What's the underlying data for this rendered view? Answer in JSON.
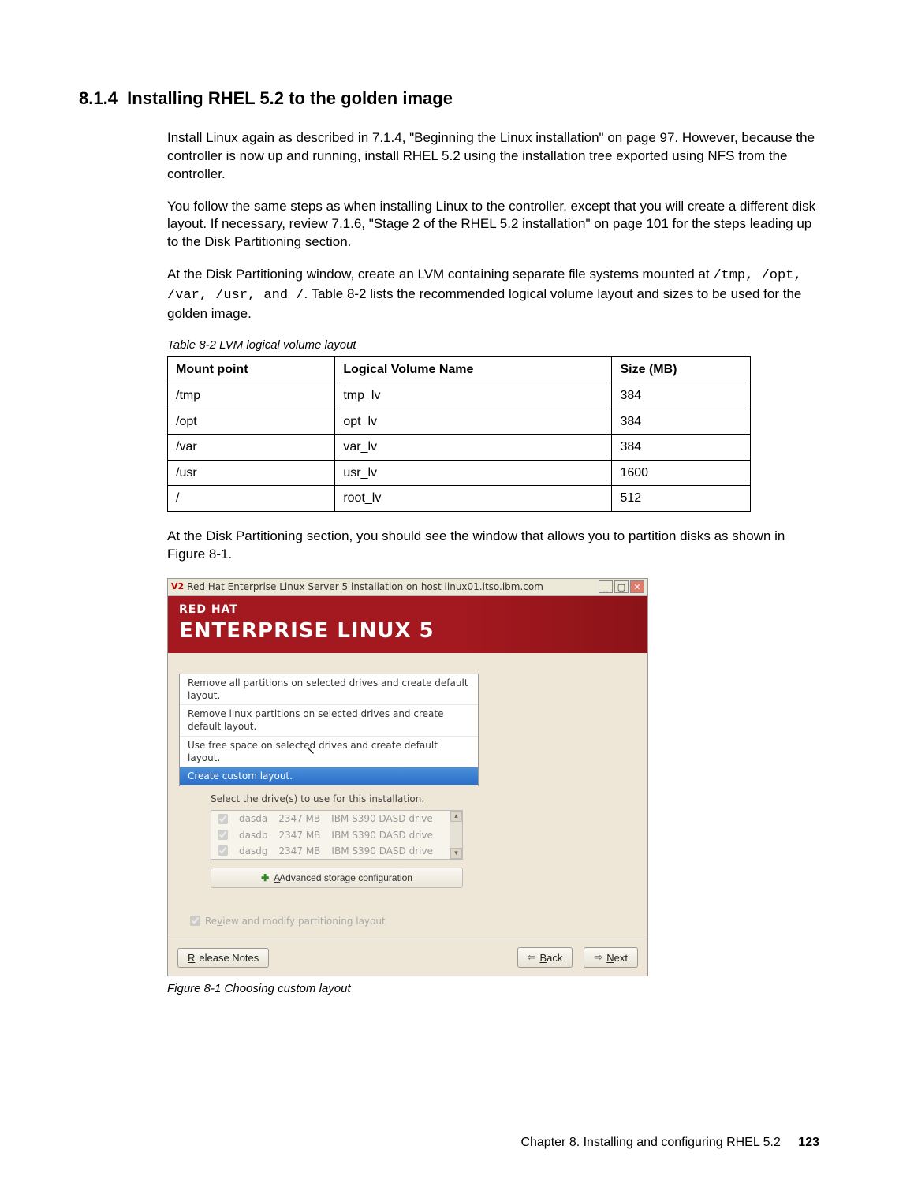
{
  "section": {
    "number": "8.1.4",
    "title": "Installing RHEL 5.2 to the golden image"
  },
  "paragraphs": {
    "p1": "Install Linux again as described in 7.1.4, \"Beginning the Linux installation\" on page 97. However, because the controller is now up and running, install RHEL 5.2 using the installation tree exported using NFS from the controller.",
    "p2": "You follow the same steps as when installing Linux to the controller, except that you will create a different disk layout. If necessary, review 7.1.6, \"Stage 2 of the RHEL 5.2 installation\" on page 101 for the steps leading up to the Disk Partitioning section.",
    "p3a": "At the Disk Partitioning window, create an LVM containing separate file systems mounted at ",
    "p3mono": "/tmp, /opt, /var, /usr, and /",
    "p3b": ". Table 8-2 lists the recommended logical volume layout and sizes to be used for the golden image.",
    "p4": "At the Disk Partitioning section, you should see the window that allows you to partition disks as shown in Figure 8-1."
  },
  "table": {
    "caption": "Table 8-2   LVM logical volume layout",
    "headers": {
      "c1": "Mount point",
      "c2": "Logical Volume Name",
      "c3": "Size (MB)"
    },
    "rows": [
      {
        "mount": "/tmp",
        "lv": "tmp_lv",
        "size": "384"
      },
      {
        "mount": "/opt",
        "lv": "opt_lv",
        "size": "384"
      },
      {
        "mount": "/var",
        "lv": "var_lv",
        "size": "384"
      },
      {
        "mount": "/usr",
        "lv": "usr_lv",
        "size": "1600"
      },
      {
        "mount": "/",
        "lv": "root_lv",
        "size": "512"
      }
    ]
  },
  "screenshot": {
    "vnc_prefix": "V2",
    "title": "Red Hat Enterprise Linux Server 5 installation on host linux01.itso.ibm.com",
    "banner_line1": "RED HAT",
    "banner_line2": "ENTERPRISE LINUX 5",
    "dropdown": {
      "opt1": "Remove all partitions on selected drives and create default layout.",
      "opt2": "Remove linux partitions on selected drives and create default layout.",
      "opt3": "Use free space on selected drives and create default layout.",
      "opt4": "Create custom layout."
    },
    "drive_prompt": "Select the drive(s) to use for this installation.",
    "drives": [
      {
        "name": "dasda",
        "size": "2347 MB",
        "desc": "IBM S390 DASD drive"
      },
      {
        "name": "dasdb",
        "size": "2347 MB",
        "desc": "IBM S390 DASD drive"
      },
      {
        "name": "dasdg",
        "size": "2347 MB",
        "desc": "IBM S390 DASD drive"
      }
    ],
    "advanced_btn": "Advanced storage configuration",
    "review_label": "Review and modify partitioning layout",
    "release_notes": "Release Notes",
    "back": "Back",
    "next": "Next"
  },
  "figure_caption": "Figure 8-1   Choosing custom layout",
  "footer": {
    "chapter": "Chapter 8. Installing and configuring RHEL 5.2",
    "page": "123"
  }
}
